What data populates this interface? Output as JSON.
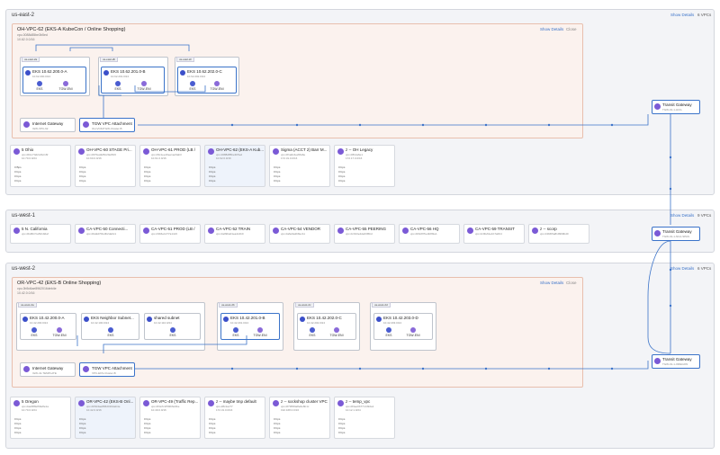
{
  "colors": {
    "accent": "#3b73c9",
    "vpc_fill": "#fbf2ee",
    "vpc_border": "#e8bfae",
    "region_bg": "#f3f4f7",
    "icon": "#7b5ad6"
  },
  "regions": [
    {
      "name": "us-east-2",
      "link": "Show Details",
      "count": "6 VPCs"
    },
    {
      "name": "us-west-1",
      "link": "Show Details",
      "count": "9 VPCs"
    },
    {
      "name": "us-west-2",
      "link": "Show Details",
      "count": "6 VPCs"
    }
  ],
  "east": {
    "vpc_title": "OH-VPC-62 (EKS-A KubeCon / Online Shopping)",
    "vpc_id": "vpc-0088d85be3b5ed",
    "vpc_cidr": "10.62.0.0/16",
    "show_details": "Show Details",
    "close": "Close",
    "az_labels": [
      "us-east-2a",
      "us-east-2b",
      "us-east-2c"
    ],
    "subnets": [
      {
        "name": "EKS 10.62.200.0-A",
        "cidr": "10.62.200.0/24",
        "eni1": "EKS",
        "eni2": "TGW-ENI"
      },
      {
        "name": "EKS 10.62.201.0-B",
        "cidr": "10.62.201.0/24",
        "eni1": "EKS",
        "eni2": "TGW-ENI"
      },
      {
        "name": "EKS 10.62.202.0-C",
        "cidr": "10.62.202.0/24",
        "eni1": "EKS",
        "eni2": "TGW-ENI"
      }
    ],
    "igw": {
      "title": "Internet Gateway",
      "sub": "IGW-VPC-62"
    },
    "tgwa": {
      "title": "TGW VPC Attachment",
      "sub": "OH-VC62TGW-Cluster-B"
    },
    "tgw": {
      "title": "Transit Gateway",
      "sub": "TGW-01-1-HUG"
    },
    "cards": [
      {
        "name": "5 Ohio",
        "id": "vpc-0b1c74d2c2bc16f",
        "cidr": "10.70.0.0/24",
        "s1": "0 Bps",
        "s2": "0 bps",
        "s3": "0 bps",
        "s4": "0 bps"
      },
      {
        "name": "OH-VPC-60 STAGE Pri...",
        "id": "vpc-0670ea9d5c20e8fc6",
        "cidr": "10.60.0.0/16",
        "s1": "0 bps",
        "s2": "0 bps",
        "s3": "0 bps",
        "s4": "0 bps"
      },
      {
        "name": "OH-VPC-61 PROD (LB /",
        "id": "vpc-09c1ee19ee1ac9ab3",
        "cidr": "10.61.0.0/16",
        "s1": "0 bps",
        "s2": "0 bps",
        "s3": "0 bps",
        "s4": "0 bps"
      },
      {
        "name": "OH-VPC-62 (EKS-A Kub...",
        "id": "vpc-0088d85be3b5ed",
        "cidr": "10.62.0.0/16",
        "s1": "0 bps",
        "s2": "0 bps",
        "s3": "0 bps",
        "s4": "0 bps"
      },
      {
        "name": "Sigma (ACCT 2) Barr M...",
        "id": "vpc-0f1a0c4e20fa6e",
        "cidr": "172.31.0.0/16",
        "s1": "0 bps",
        "s2": "0 bps",
        "s3": "0 bps",
        "s4": "0 bps"
      },
      {
        "name": "z -- OH Legacy",
        "id": "vpc-0812a6e1",
        "cidr": "172.17.0.0/16",
        "s1": "0 bps",
        "s2": "0 bps",
        "s3": "0 bps",
        "s4": "0 bps"
      }
    ]
  },
  "west1": {
    "tgw": {
      "title": "Transit Gateway",
      "sub": "TGW-01-1-NCA-SPAS"
    },
    "cards": [
      {
        "name": "5 N. California",
        "id": "vpc-0bd6b7ca5219daf"
      },
      {
        "name": "CA-VPC-50 Connecti...",
        "id": "vpc-0ba9d70fe3b2da0c1"
      },
      {
        "name": "CA-VPC-51 PROD (LB /",
        "id": "vpc-03b6e1277a14c6"
      },
      {
        "name": "CA-VPC-52 TRAIN",
        "id": "vpc-0a09ba01ea4c2b0"
      },
      {
        "name": "CA-VPC-54 VENDOR",
        "id": "vpc-0a6e9a2b8ec11"
      },
      {
        "name": "CA-VPC-55 PEERING",
        "id": "vpc-0c013e4de03f6bd"
      },
      {
        "name": "CA-VPC-56 HQ",
        "id": "vpc-0b6c87be4b8f2e1"
      },
      {
        "name": "CA-VPC-59 TRANSIT",
        "id": "vpc-0c0fe61e1b7a0b4"
      },
      {
        "name": "z -- scorp",
        "id": "vpc-04b6f6a819999bd0"
      }
    ]
  },
  "west2": {
    "vpc_title": "OR-VPC-42 (EKS-B Online Shopping)",
    "vpc_id": "vpc-0b5d4ae8962016deb4e",
    "vpc_cidr": "10.42.0.0/16",
    "show_details": "Show Details",
    "close": "Close",
    "az_labels": [
      "us-west-2a",
      "us-west-2b",
      "us-west-2c",
      "us-west-2d"
    ],
    "subnets": [
      {
        "name": "EKS 10.42.200.0-A",
        "cidr": "10.42.200.0/24",
        "eni1": "EKS",
        "eni2": "TGW-ENI"
      },
      {
        "name": "EKS Neighbor Subnet...",
        "cidr": "10.42.100.0/24",
        "eni1": "EKS",
        "eni2": ""
      },
      {
        "name": "shared subnet",
        "cidr": "10.42.110.0/24",
        "eni1": "EKS",
        "eni2": ""
      },
      {
        "name": "EKS 10.42.201.0-B",
        "cidr": "10.42.201.0/24",
        "eni1": "EKS",
        "eni2": "TGW-ENI"
      },
      {
        "name": "EKS 10.42.202.0-C",
        "cidr": "10.42.202.0/24",
        "eni1": "EKS",
        "eni2": "TGW-ENI"
      },
      {
        "name": "EKS 10.42.203.0-D",
        "cidr": "10.42.203.0/24",
        "eni1": "EKS",
        "eni2": "TGW-ENI"
      }
    ],
    "igw": {
      "title": "Internet Gateway",
      "sub": "IGW-41-TEMPLATE"
    },
    "tgwa": {
      "title": "TGW VPC Attachment",
      "sub": "VPC-EKS-Cluster-B"
    },
    "tgw": {
      "title": "Transit Gateway",
      "sub": "TGW-01-1-OREGON"
    },
    "cards": [
      {
        "name": "5 Oregon",
        "id": "vpc-0aaf3f8ef69e8e1a",
        "cidr": "10.70.0.0/24",
        "s1": "0 bps",
        "s2": "0 bps",
        "s3": "0 bps",
        "s4": "0 bps"
      },
      {
        "name": "OR-VPC-42 (EKS-B Onl...",
        "id": "vpc-0b5d4ae8962016deb4e",
        "cidr": "10.42.0.0/16",
        "s1": "0 bps",
        "s2": "0 bps",
        "s3": "0 bps",
        "s4": "0 bps"
      },
      {
        "name": "OR-VPC-49 (Traffic Rep...",
        "id": "vpc-0f4a7c1f5f2b6e9be",
        "cidr": "10.49.0.0/16",
        "s1": "0 bps",
        "s2": "0 bps",
        "s3": "0 bps",
        "s4": "0 bps"
      },
      {
        "name": "z -- maybe tmp default",
        "id": "vpc-d8c1ac77",
        "cidr": "172.31.0.0/16",
        "s1": "0 bps",
        "s2": "0 bps",
        "s3": "0 bps",
        "s4": "0 bps"
      },
      {
        "name": "z -- sockshop cluster VPC",
        "id": "vpc-0f70f9f4a8e6e6b1c",
        "cidr": "192.168.0.0/16",
        "s1": "0 bps",
        "s2": "0 bps",
        "s3": "0 bps",
        "s4": "0 bps"
      },
      {
        "name": "z -- temp_vpc",
        "id": "vpc-0f4ee0b77c1492a1",
        "cidr": "10.12.1.0/24",
        "s1": "0 bps",
        "s2": "0 bps",
        "s3": "0 bps",
        "s4": "0 bps"
      }
    ]
  }
}
